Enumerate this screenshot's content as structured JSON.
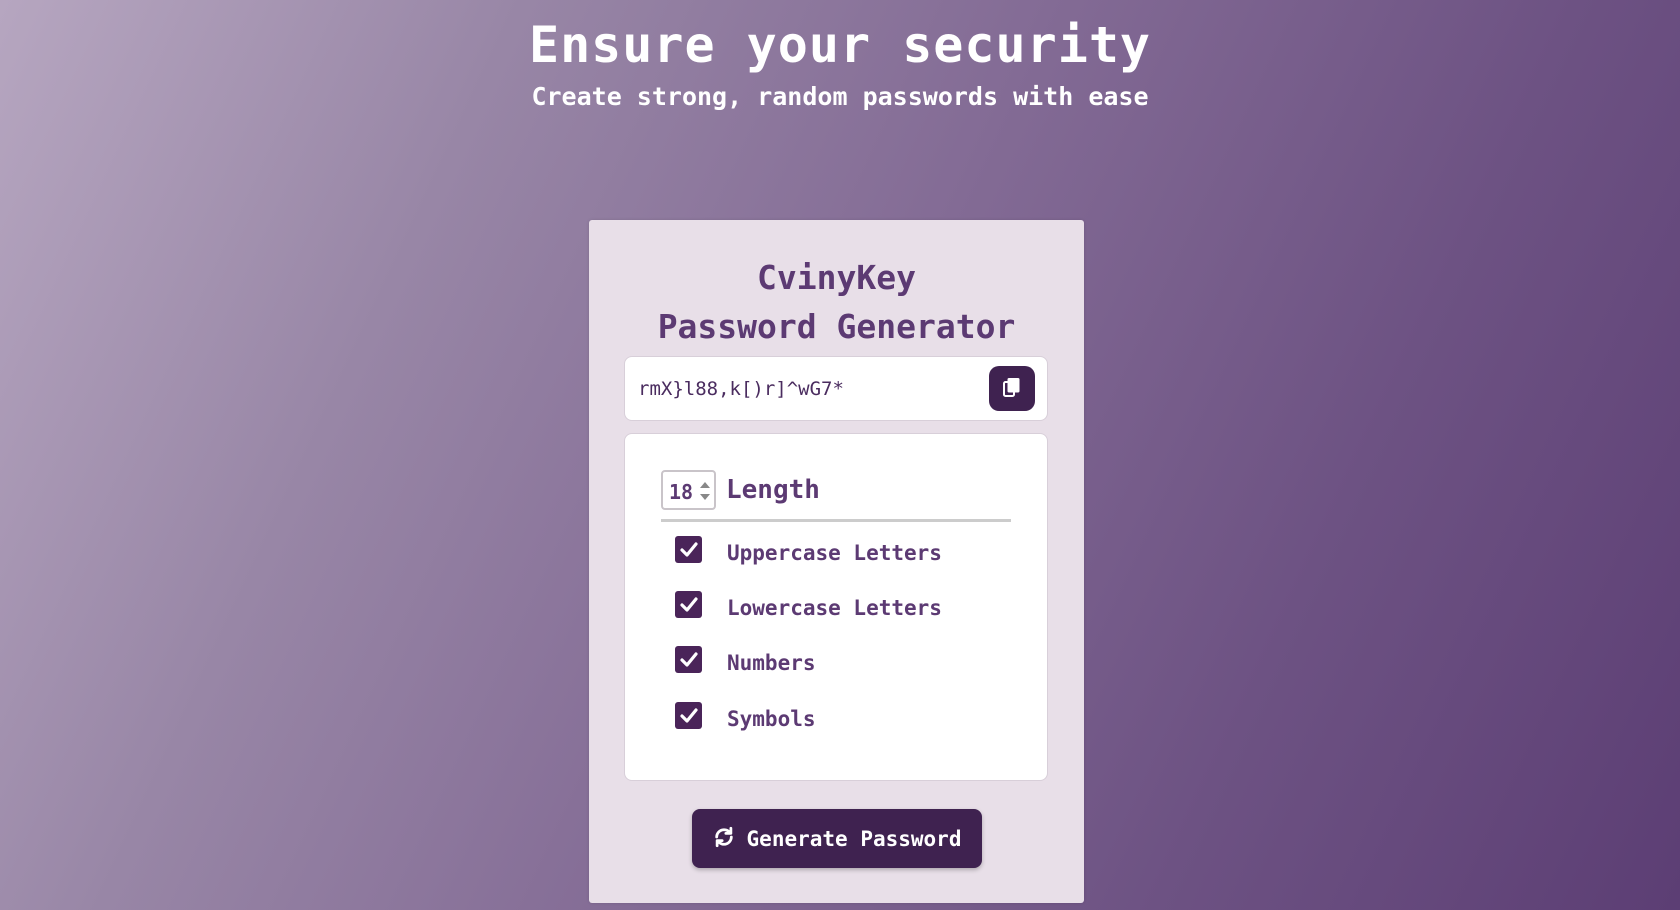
{
  "hero": {
    "title": "Ensure your security",
    "subtitle": "Create strong, random passwords with ease"
  },
  "card": {
    "brand": "CvinyKey",
    "subtitle": "Password Generator",
    "password": "rmX}l88,k[)r]^wG7*",
    "copy_icon": "copy-icon",
    "length": {
      "value": "18",
      "label": "Length"
    },
    "options": [
      {
        "label": "Uppercase Letters",
        "checked": true
      },
      {
        "label": "Lowercase Letters",
        "checked": true
      },
      {
        "label": "Numbers",
        "checked": true
      },
      {
        "label": "Symbols",
        "checked": true
      }
    ],
    "generate": {
      "label": "Generate Password",
      "icon": "refresh-icon"
    }
  },
  "colors": {
    "accent": "#3f2250",
    "text_purple": "#5c3a73",
    "card_bg": "#e8dfe8"
  }
}
